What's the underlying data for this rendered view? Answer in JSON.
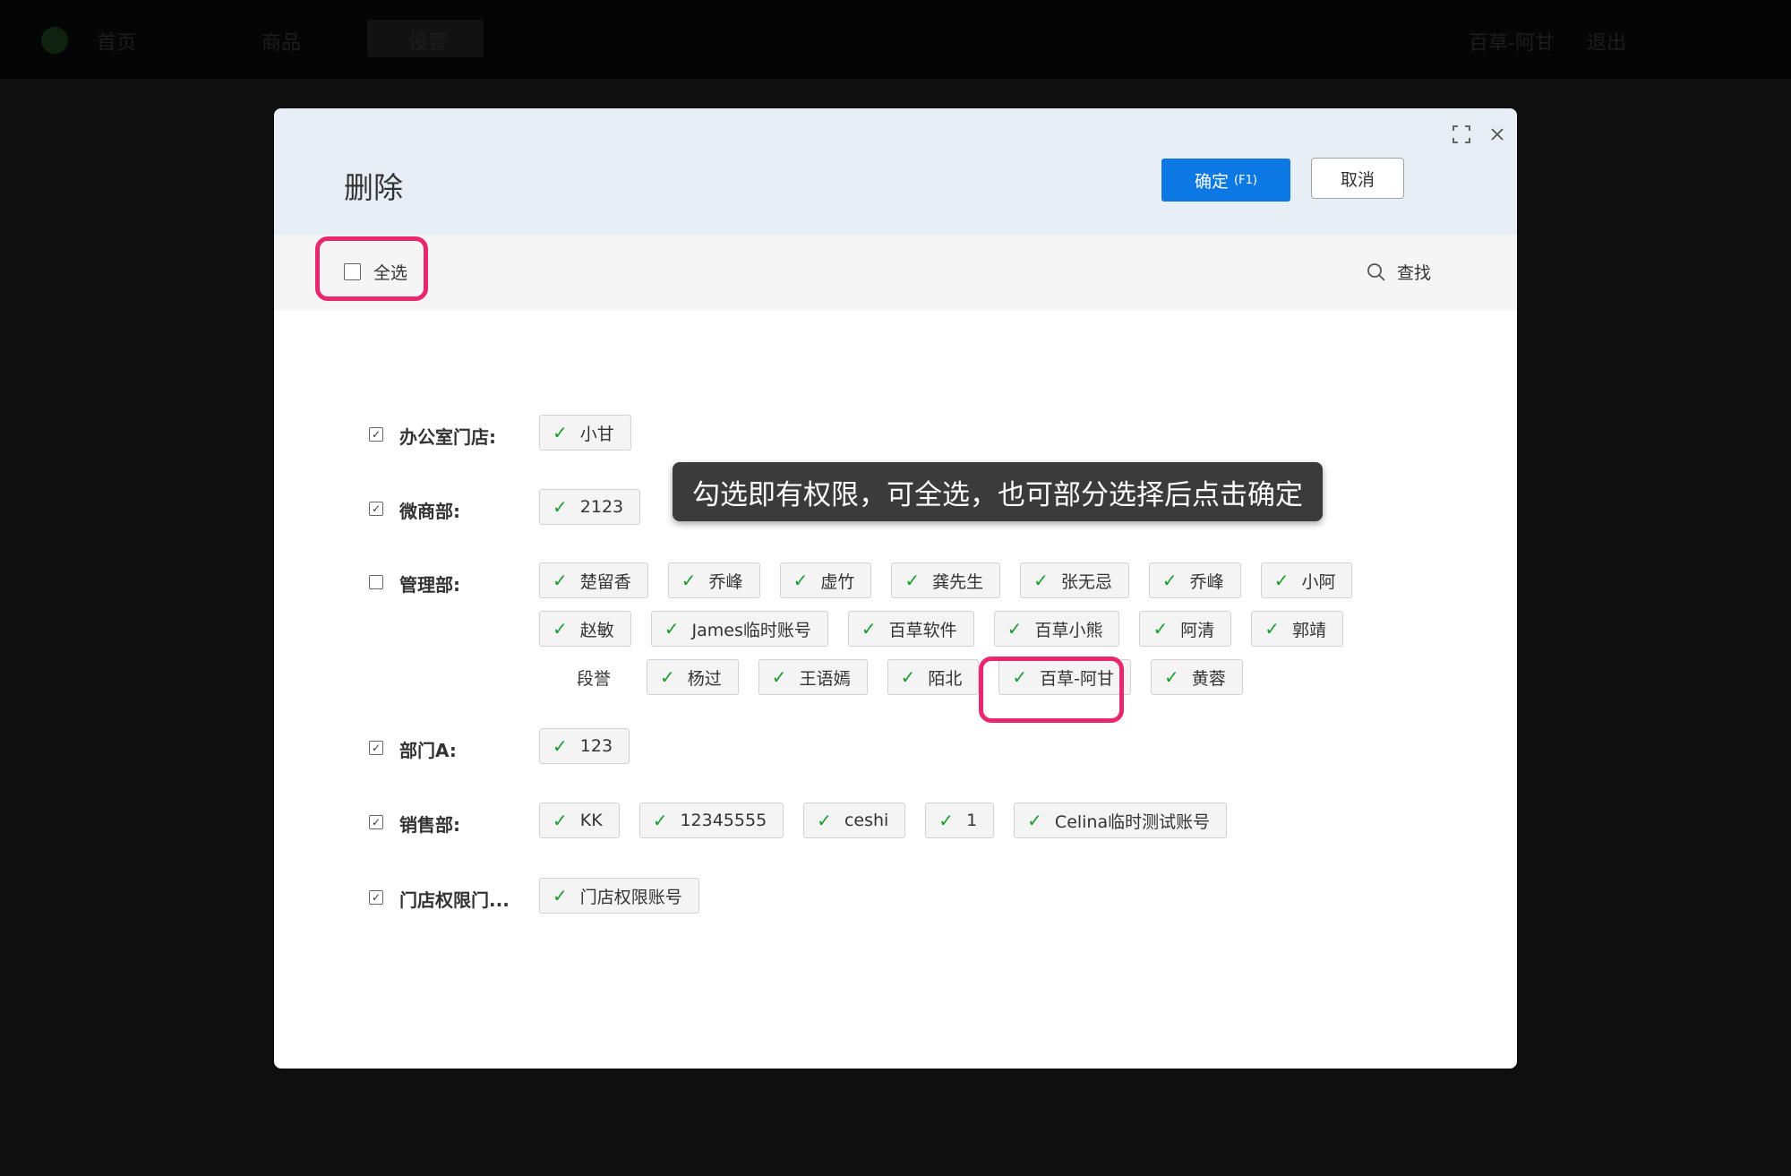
{
  "background_app": {
    "nav": [
      "首页",
      "商品",
      "设置"
    ],
    "right": [
      "百草-阿甘",
      "退出"
    ]
  },
  "modal": {
    "title": "删除",
    "confirm_label": "确定",
    "confirm_hotkey": "(F1)",
    "cancel_label": "取消",
    "select_all_label": "全选",
    "search_label": "查找",
    "icons": {
      "expand": "expand-icon",
      "close": "close-icon",
      "search": "search-icon",
      "check": "check-icon"
    }
  },
  "departments": [
    {
      "name": "办公室门店:",
      "checked": true,
      "members": [
        "小甘"
      ]
    },
    {
      "name": "微商部:",
      "checked": true,
      "members": [
        "2123"
      ]
    },
    {
      "name": "管理部:",
      "checked": false,
      "members": [
        "楚留香",
        "乔峰",
        "虚竹",
        "龚先生",
        "张无忌",
        "乔峰",
        "小阿",
        "赵敏",
        "James临时账号",
        "百草软件",
        "百草小熊",
        "阿清",
        "郭靖",
        "段誉",
        "杨过",
        "王语嫣",
        "陌北",
        "百草-阿甘",
        "黄蓉"
      ],
      "unchecked_members": [
        "段誉"
      ]
    },
    {
      "name": "部门A:",
      "checked": true,
      "members": [
        "123"
      ]
    },
    {
      "name": "销售部:",
      "checked": true,
      "members": [
        "KK",
        "12345555",
        "ceshi",
        "1",
        "Celina临时测试账号"
      ]
    },
    {
      "name": "门店权限门...",
      "checked": true,
      "members": [
        "门店权限账号"
      ]
    }
  ],
  "tooltip": "勾选即有权限，可全选，也可部分选择后点击确定",
  "colors": {
    "accent": "#0b78e3",
    "check": "#1a9b2e",
    "highlight": "#e8276e",
    "tooltip_bg": "#3b3b3b"
  }
}
